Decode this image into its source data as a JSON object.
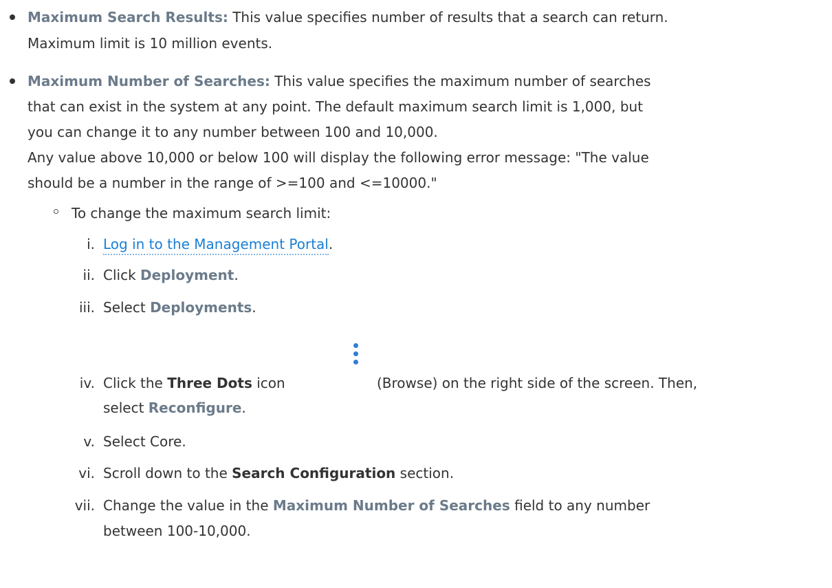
{
  "sections": {
    "max_results": {
      "label": "Maximum Search Results:",
      "text1": " This value specifies number of results that a search can return.",
      "text2": "Maximum limit is 10 million events."
    },
    "max_searches": {
      "label": "Maximum Number of Searches:",
      "text1": " This value specifies the maximum number of searches",
      "text2": "that can exist in the system at any point. The default maximum search limit is 1,000, but",
      "text3": "you can change it to any number between 100 and 10,000.",
      "text4": "Any value above 10,000 or below 100 will display the following error message: \"The value",
      "text5": "should be a number in the range of >=100 and <=10000.\""
    }
  },
  "procedure": {
    "intro": "To change the maximum search limit:",
    "steps": [
      {
        "num": "i.",
        "pre": "",
        "link": "Log in to the Management Portal",
        "post": "."
      },
      {
        "num": "ii.",
        "pre": "Click ",
        "term": "Deployment",
        "post": "."
      },
      {
        "num": "iii.",
        "pre": "Select ",
        "term": "Deployments",
        "post": "."
      },
      {
        "num": "iv.",
        "pre": "Click the ",
        "bold": "Three Dots",
        "mid": " icon",
        "after_icon": "(Browse) on the right side of the screen. Then,",
        "line2_pre": "select ",
        "term": "Reconfigure",
        "post": "."
      },
      {
        "num": "v.",
        "text": "Select Core."
      },
      {
        "num": "vi.",
        "pre": "Scroll down to the ",
        "bold": "Search Configuration",
        "post": " section."
      },
      {
        "num": "vii.",
        "pre": "Change the value in the ",
        "term": "Maximum Number of Searches",
        "post": " field to any number",
        "line2": "between 100-10,000."
      }
    ]
  },
  "icons": {
    "three_dots": "vertical-ellipsis-icon",
    "three_dots_color": "#2f7fd8"
  }
}
